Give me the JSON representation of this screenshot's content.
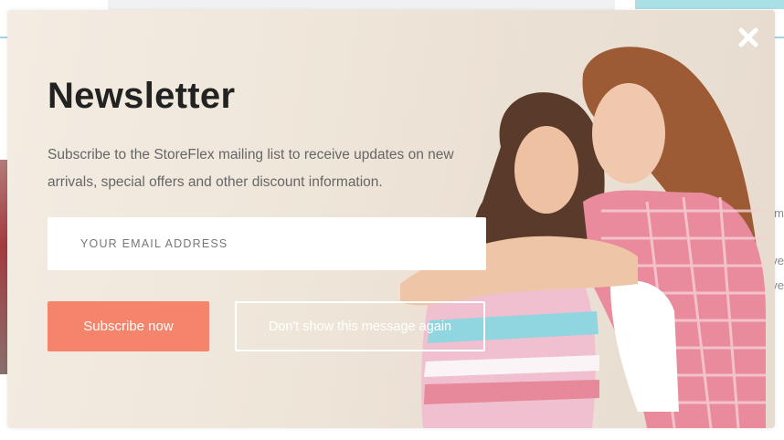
{
  "modal": {
    "title": "Newsletter",
    "description": "Subscribe to the StoreFlex mailing list to receive updates on new arrivals, special offers and other discount information.",
    "email_placeholder": "YOUR EMAIL ADDRESS",
    "subscribe_label": "Subscribe now",
    "dont_show_label": "Don't show this message again",
    "close_icon": "close-icon"
  },
  "background_page": {
    "right_fragments": [
      "m",
      "ve",
      "ve"
    ]
  },
  "colors": {
    "accent": "#f4846b",
    "title": "#222222",
    "teal": "#9fd8dc",
    "modal_bg": "#efe6da"
  }
}
